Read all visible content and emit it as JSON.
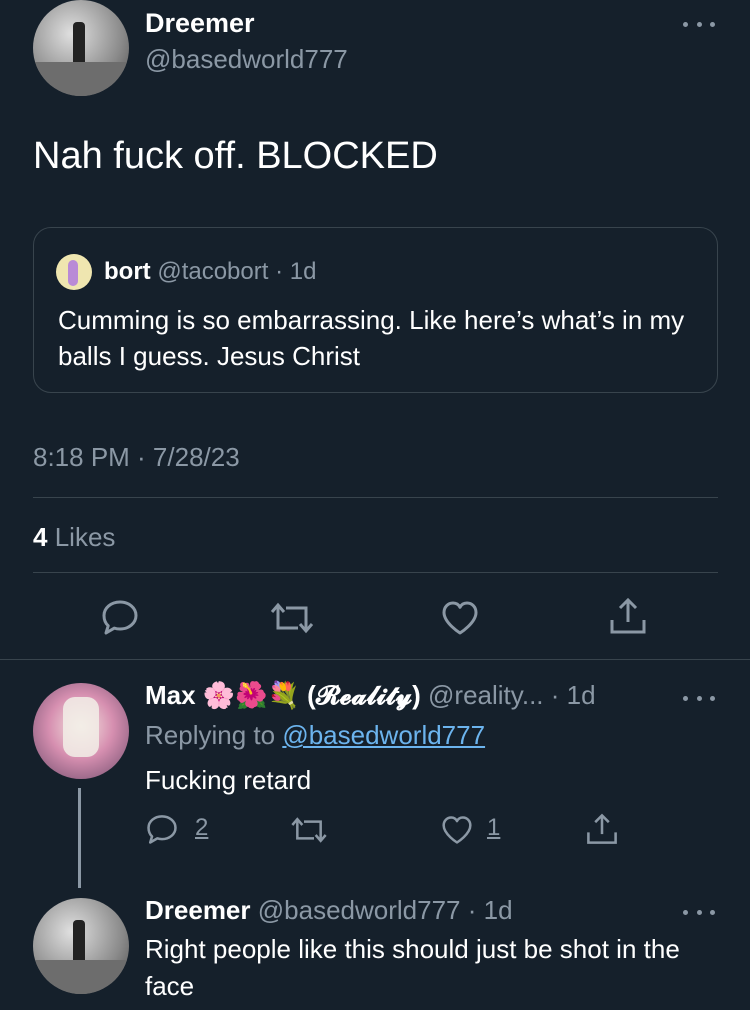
{
  "main_tweet": {
    "author_name": "Dreemer",
    "author_handle": "@basedworld777",
    "text": "Nah fuck off. BLOCKED",
    "timestamp": "8:18 PM · 7/28/23",
    "likes_count": "4",
    "likes_label": "Likes"
  },
  "quoted_tweet": {
    "author_name": "bort",
    "author_handle": "@tacobort",
    "age": "· 1d",
    "text": "Cumming is so embarrassing. Like here’s what’s in my balls I guess. Jesus Christ"
  },
  "reply_1": {
    "author_name": "Max",
    "emojis": "🌸🌺💐",
    "author_tag": "(𝓡𝓮𝓪𝓵𝓲𝓽𝔂)",
    "author_handle": "@reality...",
    "age": "· 1d",
    "replying_prefix": "Replying to",
    "replying_handle": "@basedworld777",
    "text": "Fucking retard",
    "reply_count": "2",
    "like_count": "1"
  },
  "reply_2": {
    "author_name": "Dreemer",
    "author_handle": "@basedworld777",
    "age": "· 1d",
    "text": "Right people like this should just be shot in the face"
  },
  "icons": {
    "reply": "reply-icon",
    "retweet": "retweet-icon",
    "like": "heart-icon",
    "share": "share-icon",
    "more": "more-icon"
  },
  "colors": {
    "background": "#15202b",
    "muted": "#8b98a5",
    "divider": "#38444d",
    "link": "#6cb4ee"
  }
}
